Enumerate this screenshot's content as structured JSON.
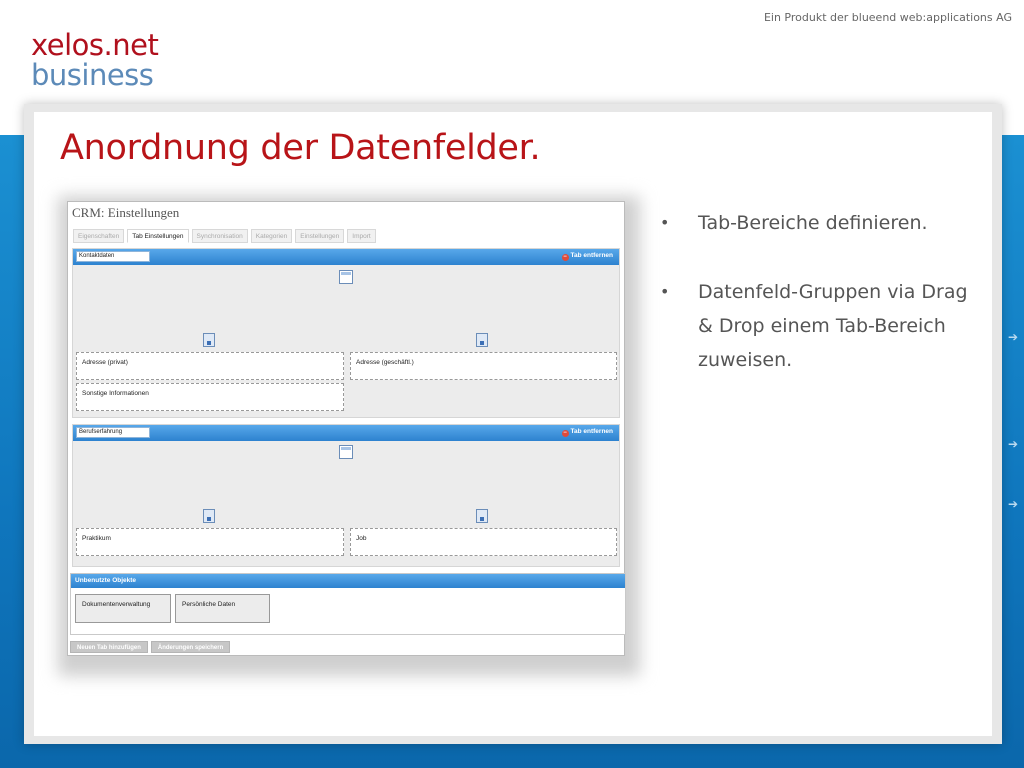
{
  "header": {
    "credit": "Ein Produkt der blueend web:applications AG",
    "logo_line1": "xelos.net",
    "logo_line2": "business"
  },
  "slide": {
    "title": "Anordnung der Datenfelder.",
    "bullets": [
      "Tab-Bereiche definieren.",
      "Datenfeld-Gruppen via Drag & Drop einem Tab-Bereich zuweisen."
    ],
    "bullet_symbol": "•",
    "arrow_symbol": "➔"
  },
  "app": {
    "title": "CRM: Einstellungen",
    "tabs": [
      "Eigenschaften",
      "Tab Einstellungen",
      "Synchronisation",
      "Kategorien",
      "Einstellungen",
      "Import"
    ],
    "active_tab": "Tab Einstellungen",
    "remove_label": "Tab entfernen",
    "sections": [
      {
        "name": "Kontaktdaten",
        "fields": [
          "Adresse (privat)",
          "Adresse (geschäftl.)",
          "Sonstige Informationen"
        ]
      },
      {
        "name": "Berufserfahrung",
        "fields": [
          "Praktikum",
          "Job"
        ]
      }
    ],
    "unused_title": "Unbenutzte Objekte",
    "unused_items": [
      "Dokumentenverwaltung",
      "Persönliche Daten"
    ],
    "buttons": {
      "add_tab": "Neuen Tab hinzufügen",
      "save": "Änderungen speichern"
    }
  },
  "colors": {
    "title_red": "#b81418",
    "logo_red": "#b0101d",
    "logo_blue": "#5c8ab8",
    "band_blue": "#1b90d2",
    "bar_blue": "#2d82cf"
  }
}
